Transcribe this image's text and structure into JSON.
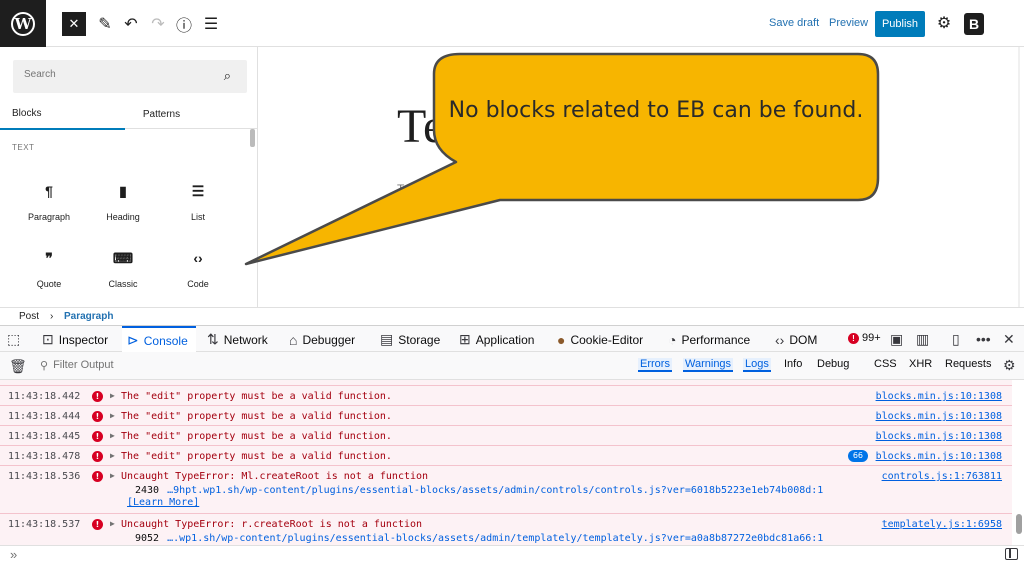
{
  "toolbar": {
    "save_draft": "Save draft",
    "preview": "Preview",
    "publish": "Publish",
    "brand_letter": "B"
  },
  "inserter": {
    "search_placeholder": "Search",
    "tabs": [
      "Blocks",
      "Patterns"
    ],
    "category": "TEXT",
    "blocks": [
      {
        "label": "Paragraph",
        "icon": "¶"
      },
      {
        "label": "Heading",
        "icon": "🔖"
      },
      {
        "label": "List",
        "icon": "☰"
      },
      {
        "label": "Quote",
        "icon": "❞"
      },
      {
        "label": "Classic",
        "icon": "⌨"
      },
      {
        "label": "Code",
        "icon": "‹›"
      }
    ]
  },
  "canvas": {
    "title": "Te",
    "hint": "Type"
  },
  "callout": {
    "text": "No blocks related to EB can be found.",
    "fill": "#f7b500"
  },
  "breadcrumb": [
    "Post",
    "Paragraph"
  ],
  "devtools": {
    "tabs": [
      "Inspector",
      "Console",
      "Network",
      "Debugger",
      "Storage",
      "Application",
      "Cookie-Editor",
      "Performance",
      "DOM"
    ],
    "active_tab": "Console",
    "error_count": "99+",
    "filter_placeholder": "Filter Output",
    "filters": [
      "Errors",
      "Warnings",
      "Logs",
      "Info",
      "Debug",
      "CSS",
      "XHR",
      "Requests"
    ]
  },
  "console": {
    "messages": [
      {
        "time": "11:43:18.442",
        "text": "The \"edit\" property must be a valid function.",
        "source": "blocks.min.js:10:1308"
      },
      {
        "time": "11:43:18.444",
        "text": "The \"edit\" property must be a valid function.",
        "source": "blocks.min.js:10:1308"
      },
      {
        "time": "11:43:18.445",
        "text": "The \"edit\" property must be a valid function.",
        "source": "blocks.min.js:10:1308"
      },
      {
        "time": "11:43:18.478",
        "text": "The \"edit\" property must be a valid function.",
        "source": "blocks.min.js:10:1308",
        "repeat": "66"
      },
      {
        "time": "11:43:18.536",
        "text": "Uncaught TypeError: Ml.createRoot is not a function",
        "source": "controls.js:1:763811",
        "stack_line": "2430",
        "stack_url": "…9hpt.wp1.sh/wp-content/plugins/essential-blocks/assets/admin/controls/controls.js?ver=6018b5223e1eb74b008d:1",
        "learn_more": "[Learn More]"
      },
      {
        "time": "11:43:18.537",
        "text": "Uncaught TypeError: r.createRoot is not a function",
        "source": "templately.js:1:6958",
        "stack_line": "9052",
        "stack_url": "….wp1.sh/wp-content/plugins/essential-blocks/assets/admin/templately/templately.js?ver=a0a8b87272e0bdc81a66:1"
      }
    ],
    "prompt": "»"
  }
}
